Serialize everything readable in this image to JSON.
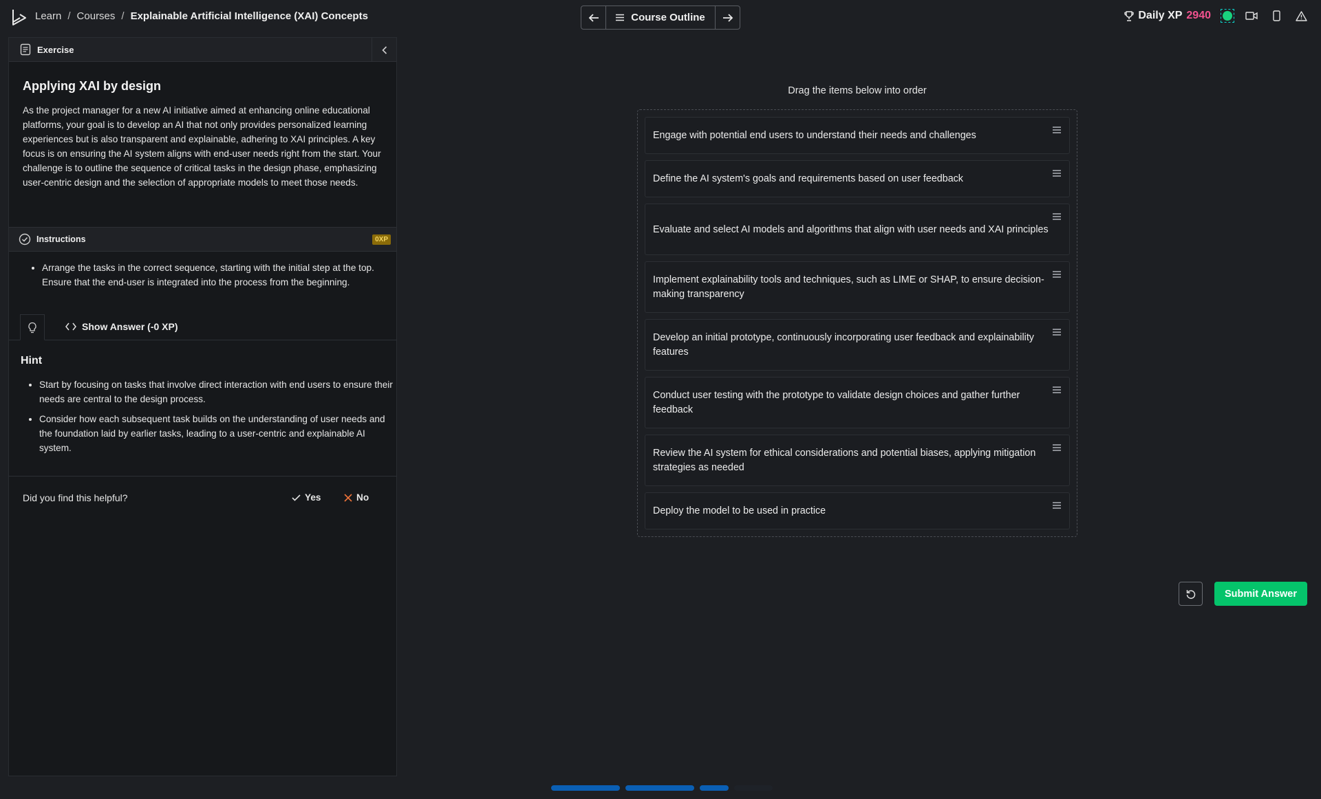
{
  "breadcrumb": {
    "items": [
      "Learn",
      "Courses"
    ],
    "separator": "/",
    "current": "Explainable Artificial Intelligence (XAI) Concepts"
  },
  "nav": {
    "outline_label": "Course Outline"
  },
  "header": {
    "xp_label": "Daily XP",
    "xp_value": "2940"
  },
  "panel": {
    "header_label": "Exercise",
    "exercise_title": "Applying XAI by design",
    "exercise_body": "As the project manager for a new AI initiative aimed at enhancing online educational platforms, your goal is to develop an AI that not only provides personalized learning experiences but is also transparent and explainable, adhering to XAI principles. A key focus is on ensuring the AI system aligns with end-user needs right from the start. Your challenge is to outline the sequence of critical tasks in the design phase, emphasizing user-centric design and the selection of appropriate models to meet those needs.",
    "instructions_label": "Instructions",
    "instructions_xp": "0XP",
    "instructions": [
      "Arrange the tasks in the correct sequence, starting with the initial step at the top. Ensure that the end-user is integrated into the process from the beginning."
    ],
    "show_answer_label": "Show Answer (-0 XP)",
    "hint_title": "Hint",
    "hints": [
      "Start by focusing on tasks that involve direct interaction with end users to ensure their needs are central to the design process.",
      "Consider how each subsequent task builds on the understanding of user needs and the foundation laid by earlier tasks, leading to a user-centric and explainable AI system."
    ],
    "helpful_question": "Did you find this helpful?",
    "yes_label": "Yes",
    "no_label": "No"
  },
  "main": {
    "drag_title": "Drag the items below into order",
    "items": [
      "Engage with potential end users to understand their needs and challenges",
      "Define the AI system's goals and requirements based on user feedback",
      "Evaluate and select AI models and algorithms that align with user needs and XAI principles",
      "Implement explainability tools and techniques, such as LIME or SHAP, to ensure decision-making transparency",
      "Develop an initial prototype, continuously incorporating user feedback and explainability features",
      "Conduct user testing with the prototype to validate design choices and gather further feedback",
      "Review the AI system for ethical considerations and potential biases, applying mitigation strategies as needed",
      "Deploy the model to be used in practice"
    ],
    "submit_label": "Submit Answer"
  },
  "colors": {
    "accent_green": "#05c46b",
    "xp_pink": "#f1528f",
    "progress_blue": "#0a5fb4",
    "xp_badge": "#8a6b09"
  },
  "icons": {
    "logo": "datacamp-logo-icon",
    "prev": "arrow-left-icon",
    "next": "arrow-right-icon",
    "outline": "menu-icon",
    "trophy": "trophy-icon",
    "video": "video-icon",
    "mobile": "mobile-icon",
    "report": "warning-icon",
    "exercise": "document-icon",
    "collapse": "chevron-left-icon",
    "instructions": "check-circle-icon",
    "hint": "lightbulb-icon",
    "code": "code-icon",
    "reset": "reset-icon",
    "grip": "drag-handle-icon"
  },
  "progress": {
    "segments_complete": 3,
    "segments_total": 4
  }
}
